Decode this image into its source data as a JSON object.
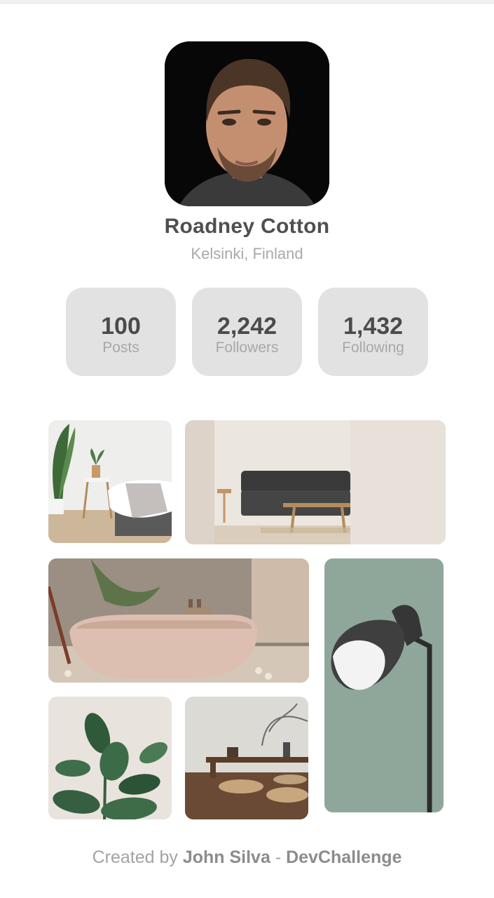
{
  "profile": {
    "name": "Roadney Cotton",
    "location": "Kelsinki, Finland"
  },
  "stats": [
    {
      "value": "100",
      "label": "Posts"
    },
    {
      "value": "2,242",
      "label": "Followers"
    },
    {
      "value": "1,432",
      "label": "Following"
    }
  ],
  "gallery": [
    {
      "subject": "bedroom-with-plant"
    },
    {
      "subject": "living-room-sofa"
    },
    {
      "subject": "bathtub"
    },
    {
      "subject": "floor-lamp"
    },
    {
      "subject": "plant-leaves"
    },
    {
      "subject": "low-table-cushions"
    }
  ],
  "footer": {
    "prefix": "Created by",
    "author": "John Silva",
    "separator": "-",
    "brand": "DevChallenge"
  }
}
